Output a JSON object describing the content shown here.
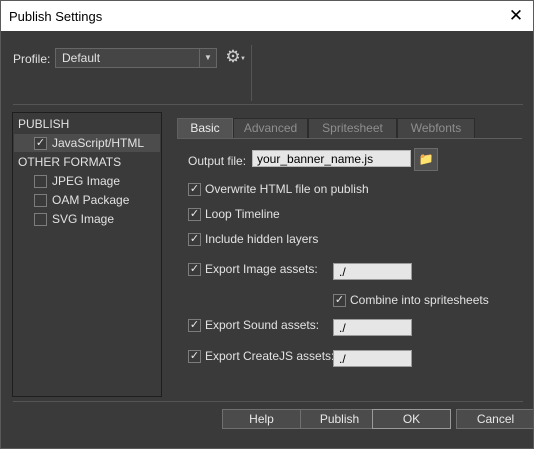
{
  "window": {
    "title": "Publish Settings",
    "close_icon": "close-icon"
  },
  "profile": {
    "label": "Profile:",
    "value": "Default",
    "gear_icon": "gear-icon"
  },
  "formats": {
    "publish_header": "PUBLISH",
    "publish_items": [
      {
        "label": "JavaScript/HTML",
        "checked": true
      }
    ],
    "other_header": "OTHER FORMATS",
    "other_items": [
      {
        "label": "JPEG Image",
        "checked": false
      },
      {
        "label": "OAM Package",
        "checked": false
      },
      {
        "label": "SVG Image",
        "checked": false
      }
    ]
  },
  "tabs": [
    {
      "label": "Basic",
      "active": true
    },
    {
      "label": "Advanced",
      "active": false
    },
    {
      "label": "Spritesheet",
      "active": false
    },
    {
      "label": "Webfonts",
      "active": false
    }
  ],
  "basic": {
    "output_label": "Output file:",
    "output_value": "your_banner_name.js",
    "folder_icon": "folder-icon",
    "options": [
      {
        "label": "Overwrite HTML file on publish",
        "checked": true
      },
      {
        "label": "Loop Timeline",
        "checked": true
      },
      {
        "label": "Include hidden layers",
        "checked": true
      }
    ],
    "image_assets": {
      "label": "Export Image assets:",
      "checked": true,
      "value": "./"
    },
    "combine_spritesheets": {
      "label": "Combine into spritesheets",
      "checked": true
    },
    "sound_assets": {
      "label": "Export Sound assets:",
      "checked": true,
      "value": "./"
    },
    "createjs_assets": {
      "label": "Export CreateJS assets:",
      "checked": true,
      "value": "./"
    }
  },
  "buttons": {
    "help": "Help",
    "publish": "Publish",
    "ok": "OK",
    "cancel": "Cancel"
  }
}
